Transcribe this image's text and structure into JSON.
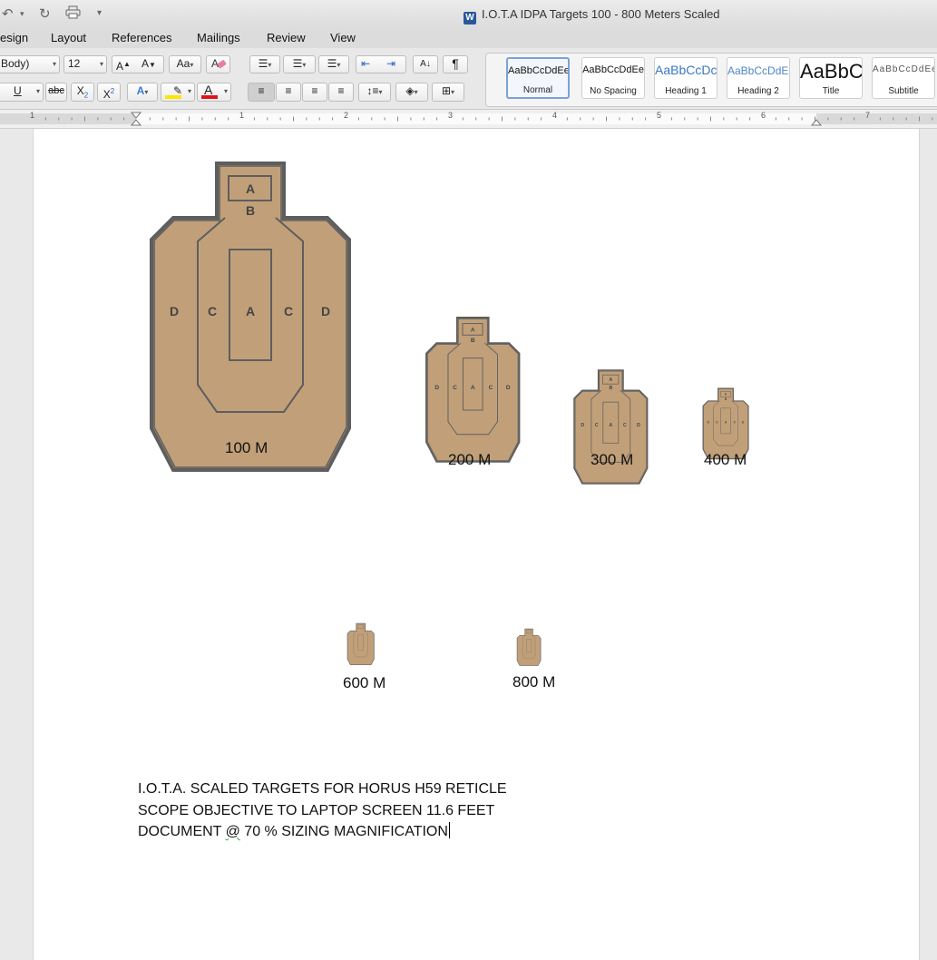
{
  "window": {
    "title": "I.O.T.A  IDPA Targets 100 - 800 Meters Scaled",
    "app_icon": "word-doc-icon"
  },
  "quick_access": {
    "undo_icon": "undo-icon",
    "redo_icon": "redo-icon",
    "print_icon": "print-icon",
    "customize_icon": "customize-icon"
  },
  "tabs": [
    "esign",
    "Layout",
    "References",
    "Mailings",
    "Review",
    "View"
  ],
  "ribbon": {
    "font_name": "Body)",
    "font_size": "12",
    "grow_font": "A",
    "shrink_font": "A",
    "change_case": "Aa",
    "strikethrough": "abc",
    "subscript": "X",
    "subscript_sub": "2",
    "superscript": "X",
    "superscript_sup": "2",
    "underline": "U",
    "font_color_label": "A",
    "text_effects": "A",
    "pilcrow": "¶",
    "colors": {
      "font_color": "#e0141b",
      "highlight": "#ffe600",
      "text_effects": "#3c7bd8"
    }
  },
  "styles": [
    {
      "sample": "AaBbCcDdEe",
      "name": "Normal",
      "selected": true
    },
    {
      "sample": "AaBbCcDdEe",
      "name": "No Spacing",
      "selected": false
    },
    {
      "sample": "AaBbCcDc",
      "name": "Heading 1",
      "selected": false
    },
    {
      "sample": "AaBbCcDdEe",
      "name": "Heading 2",
      "selected": false
    },
    {
      "sample": "AaBbC",
      "name": "Title",
      "selected": false
    },
    {
      "sample": "AaBbCcDdEe",
      "name": "Subtitle",
      "selected": false
    }
  ],
  "ruler": {
    "numbers": [
      "1",
      "1",
      "2",
      "3",
      "4",
      "5",
      "6",
      "7"
    ]
  },
  "document": {
    "target_colors": {
      "fill": "#c1a079",
      "stroke": "#5e5e5e"
    },
    "target_zone_letters": [
      "A",
      "B",
      "C",
      "D"
    ],
    "captions": [
      "100 M",
      "200 M",
      "300 M",
      "400 M",
      "600 M",
      "800 M"
    ],
    "text_lines": [
      "I.O.T.A.    SCALED TARGETS FOR HORUS H59 RETICLE",
      "SCOPE OBJECTIVE TO LAPTOP SCREEN 11.6 FEET"
    ],
    "line3_a": "DOCUMENT ",
    "line3_at": "@",
    "line3_b": "  70 % SIZING MAGNIFICATION"
  }
}
